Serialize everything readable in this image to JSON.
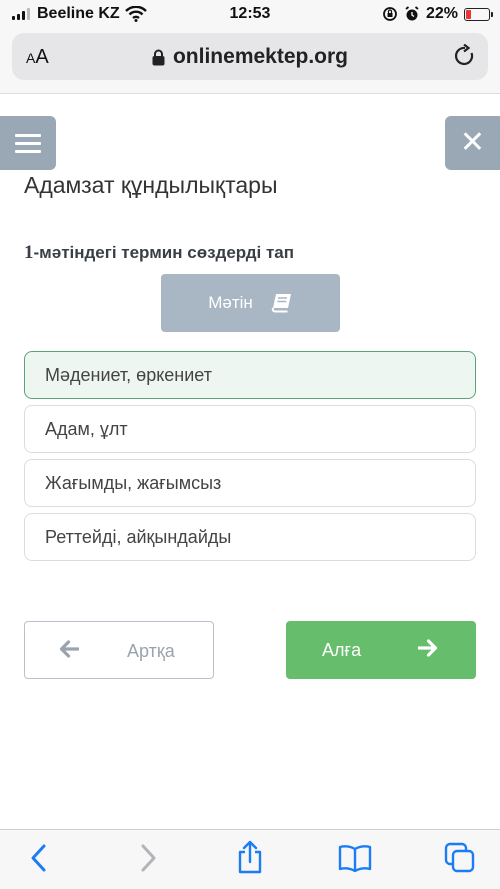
{
  "status_bar": {
    "carrier": "Beeline KZ",
    "time": "12:53",
    "battery_percent": "22%",
    "battery_level": 0.22,
    "icons": [
      "signal-icon",
      "wifi-icon",
      "screen-rotation-lock-icon",
      "alarm-icon",
      "battery-icon"
    ]
  },
  "browser": {
    "text_size_small": "A",
    "text_size_large": "A",
    "url": "onlinemektep.org",
    "icons": [
      "lock-icon",
      "reload-icon"
    ]
  },
  "page": {
    "title": "Адамзат құндылықтары",
    "question_number": "1",
    "question_text": "-мәтіндегі термин сөздерді тап",
    "text_button_label": "Мәтін",
    "options": [
      {
        "label": "Мәдениет, өркениет",
        "selected": true
      },
      {
        "label": "Адам, ұлт",
        "selected": false
      },
      {
        "label": "Жағымды, жағымсыз",
        "selected": false
      },
      {
        "label": "Реттейді, айқындайды",
        "selected": false
      }
    ],
    "back_label": "Артқа",
    "next_label": "Алға",
    "icons": [
      "menu-icon",
      "close-icon",
      "book-icon",
      "arrow-left-icon",
      "arrow-right-icon"
    ]
  },
  "toolbar": {
    "icons": [
      "back-icon",
      "forward-icon",
      "share-icon",
      "bookmarks-icon",
      "tabs-icon"
    ]
  },
  "colors": {
    "menu_button": "#9aa8b6",
    "text_button": "#a9b6c3",
    "selected_option_bg": "#eef6f1",
    "selected_option_border": "#5da37a",
    "next_button": "#66bd6c",
    "ios_blue": "#1b7cf5"
  }
}
